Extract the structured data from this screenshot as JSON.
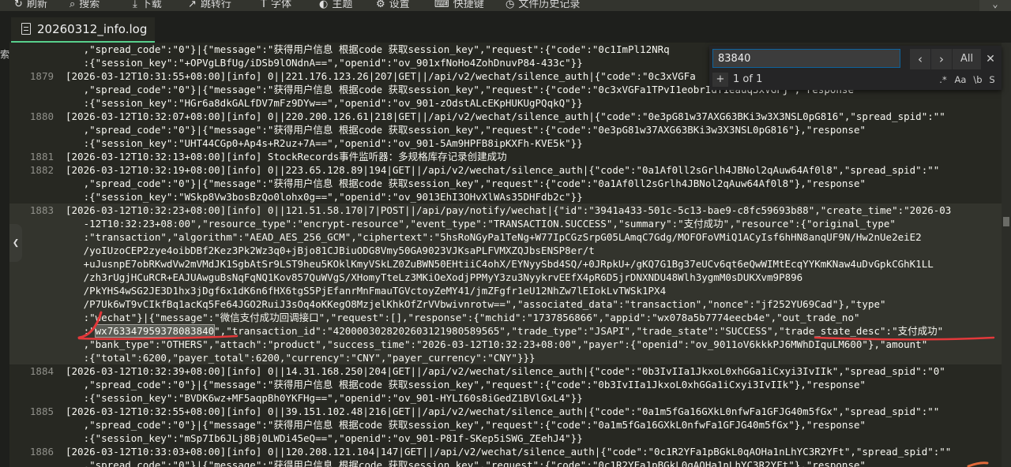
{
  "toolbar": {
    "items": [
      {
        "label": "刷新",
        "icon": "refresh-icon"
      },
      {
        "label": "搜索",
        "icon": "search-icon"
      },
      {
        "label": "下载",
        "icon": "download-icon"
      },
      {
        "label": "跳转行",
        "icon": "goto-line-icon"
      },
      {
        "label": "字体",
        "icon": "font-icon"
      },
      {
        "label": "主题",
        "icon": "theme-icon"
      },
      {
        "label": "设置",
        "icon": "gear-icon"
      },
      {
        "label": "快捷键",
        "icon": "keyboard-icon"
      },
      {
        "label": "文件历史记录",
        "icon": "history-icon"
      }
    ],
    "corner_icon": "chevron-down-icon"
  },
  "tab": {
    "title": "20260312_info.log",
    "icon": "file-icon"
  },
  "left_panel": {
    "text": "索",
    "collapse_icon": "chevron-left-icon"
  },
  "colors": {
    "background": "#272822",
    "text": "#f8f8f2",
    "line_number": "#90908a",
    "accent": "#58d08c",
    "annotation": "#e3393b"
  },
  "find": {
    "query": "83840",
    "placeholder": "",
    "prev_icon": "chevron-left-icon",
    "next_icon": "chevron-right-icon",
    "all_label": "All",
    "close_icon": "close-icon",
    "replace_toggle": "+",
    "result": "1 of 1",
    "options": [
      ".*",
      "Aa",
      "\\b",
      "S"
    ]
  },
  "lines": [
    {
      "ln": "",
      "text": "   ,\"spread_code\":\"0\"}|{\"message\":\"获得用户信息 根据code 获取session_key\",\"request\":{\"code\":\"0c1ImPl12NRq"
    },
    {
      "ln": "",
      "text": "   :{\"session_key\":\"+OPVgLBfUg/iDSb9lONdnA==\",\"openid\":\"ov_901xfNoHo4ZohDnuvP84-433c\"}}"
    },
    {
      "ln": "1879",
      "text": "[2026-03-12T10:31:55+08:00][info] 0||221.176.123.26|207|GET||/api/v2/wechat/silence_auth|{\"code\":\"0c3xVGFa"
    },
    {
      "ln": "",
      "text": "   ,\"spread_code\":\"0\"}|{\"message\":\"获得用户信息 根据code 获取session_key\",\"request\":{\"code\":\"0c3xVGFa1TPvI1eobrIdf1eauq3xVGFj\",\"response\""
    },
    {
      "ln": "",
      "text": "   :{\"session_key\":\"HGr6a8dkGALfDV7mFz9DYw==\",\"openid\":\"ov_901-zOdstALcEKpHUKUgPQqkQ\"}}"
    },
    {
      "ln": "1880",
      "text": "[2026-03-12T10:32:07+08:00][info] 0||220.200.126.61|218|GET||/api/v2/wechat/silence_auth|{\"code\":\"0e3pG81w37AXG63BKi3w3X3NSL0pG816\",\"spread_spid\":\"\""
    },
    {
      "ln": "",
      "text": "   ,\"spread_code\":\"0\"}|{\"message\":\"获得用户信息 根据code 获取session_key\",\"request\":{\"code\":\"0e3pG81w37AXG63BKi3w3X3NSL0pG816\"},\"response\""
    },
    {
      "ln": "",
      "text": "   :{\"session_key\":\"UHT44CGp0+Ap4s+R2uz+7A==\",\"openid\":\"ov_901-5Am9HPFB8ipKXFh-KVE5k\"}}"
    },
    {
      "ln": "1881",
      "text": "[2026-03-12T10:32:13+08:00][info] StockRecords事件监听器：多规格库存记录创建成功"
    },
    {
      "ln": "1882",
      "text": "[2026-03-12T10:32:19+08:00][info] 0||223.65.128.89|194|GET||/api/v2/wechat/silence_auth|{\"code\":\"0a1Af0ll2sGrlh4JBNol2qAuw64Af0l8\",\"spread_spid\":\"\""
    },
    {
      "ln": "",
      "text": "   ,\"spread_code\":\"0\"}|{\"message\":\"获得用户信息 根据code 获取session_key\",\"request\":{\"code\":\"0a1Af0ll2sGrlh4JBNol2qAuw64Af0l8\"},\"response\""
    },
    {
      "ln": "",
      "text": "   :{\"session_key\":\"WSkp8Vw3bosBzQo0lohx0g==\",\"openid\":\"ov_9013EhI3OHvXlWAs35DHFdb2c\"}}"
    },
    {
      "ln": "1883",
      "text": "[2026-03-12T10:32:23+08:00][info] 0||121.51.58.170|7|POST||/api/pay/notify/wechat|{\"id\":\"3941a433-501c-5c13-bae9-c8fc59693b88\",\"create_time\":\"2026-03"
    },
    {
      "ln": "",
      "text": "   -12T10:32:23+08:00\",\"resource_type\":\"encrypt-resource\",\"event_type\":\"TRANSACTION.SUCCESS\",\"summary\":\"支付成功\",\"resource\":{\"original_type\""
    },
    {
      "ln": "",
      "text": "   :\"transaction\",\"algorithm\":\"AEAD_AES_256_GCM\",\"ciphertext\":\"5hsRoNGyPa1TeNg+W77IpCGzSrpG05LAmqC7Gdg/MOFOFoVMiQ1ACyIsf6hHN8anqUF9N/Hw2nUe2eiE2"
    },
    {
      "ln": "",
      "text": "   /yoIUzoCEP2zye4oibDBf2Kez3Pk2Wz3q0+jBjo81CJBiuODG8Vmy50GA9023VJKsaPLFVMXZQJbsENSP8er/t"
    },
    {
      "ln": "",
      "text": "   +uJusnpE7obRKwdVw2mVMdJK1SgbAtSr9LST9heu5KOklKmyVSkLZ0ZuBWN50EHtiiC4ohX/EYNyySbd4SQ/+0JRpkU+/gKQ7G1Bg37eUCv6qt6eQwWIMtEcqYYKmKNaw4uDvGpkCGhK1LL"
    },
    {
      "ln": "",
      "text": "   /zh3rUgjHCuRCR+EAJUAwguBsNqFqNQ1Kov857QuWVgS/XHomyTteLz3MKiOeXodjPPMyY3zu3NyykrvEEfX4pR6D5jrDNXNDU48Wlh3ygmM0sDUKXvm9P896"
    },
    {
      "ln": "",
      "text": "   /PkYHS4wSG2JE3D1hx3jDgf6x1dK6n6fHX6tgS5PjEfanrMnFmauTGVctoyZeMY41/jmZFgfr1eU12NhZw7lEIokLvTWSk1PX4"
    },
    {
      "ln": "",
      "text": "   /P7Uk6wT9vCIkfBq1acKq5Fe64JGO2RuiJ3sOq4oKKegO8MzjelKhkOfZrVVbwivnrotw==\",\"associated_data\":\"transaction\",\"nonce\":\"jf252YU69Cad\"},\"type\""
    },
    {
      "ln": "",
      "text": "   :\"wechat\"}|{\"message\":\"微信支付成功回调接口\",\"request\":[],\"response\":{\"mchid\":\"1737856866\",\"appid\":\"wx078a5b7774eecb4e\",\"out_trade_no\""
    },
    {
      "ln": "",
      "prefix": "   :\"",
      "match": "wx763347959378083840",
      "suffix": "\",\"transaction_id\":\"4200003028202603121980589565\",\"trade_type\":\"JSAPI\",\"trade_state\":\"SUCCESS\",\"trade_state_desc\":\"支付成功\""
    },
    {
      "ln": "",
      "text": "   ,\"bank_type\":\"OTHERS\",\"attach\":\"product\",\"success_time\":\"2026-03-12T10:32:23+08:00\",\"payer\":{\"openid\":\"ov_9011oV6kkkPJ6MWhDIquLM600\"},\"amount\""
    },
    {
      "ln": "",
      "text": "   :{\"total\":6200,\"payer_total\":6200,\"currency\":\"CNY\",\"payer_currency\":\"CNY\"}}}"
    },
    {
      "ln": "1884",
      "text": "[2026-03-12T10:32:39+08:00][info] 0||14.31.168.250|204|GET||/api/v2/wechat/silence_auth|{\"code\":\"0b3IvIIa1JkxoL0xhGGa1iCxyi3IvIIk\",\"spread_spid\":\"0\""
    },
    {
      "ln": "",
      "text": "   ,\"spread_code\":\"0\"}|{\"message\":\"获得用户信息 根据code 获取session_key\",\"request\":{\"code\":\"0b3IvIIa1JkxoL0xhGGa1iCxyi3IvIIk\"},\"response\""
    },
    {
      "ln": "",
      "text": "   :{\"session_key\":\"BVDK6wz+MF5aqpBh0YKFHg==\",\"openid\":\"ov_901-HYLI60s8iGedZ1BVlGxL4\"}}"
    },
    {
      "ln": "1885",
      "text": "[2026-03-12T10:32:55+08:00][info] 0||39.151.102.48|216|GET||/api/v2/wechat/silence_auth|{\"code\":\"0a1m5fGa16GXkL0nfwFa1GFJG40m5fGx\",\"spread_spid\":\"\""
    },
    {
      "ln": "",
      "text": "   ,\"spread_code\":\"0\"}|{\"message\":\"获得用户信息 根据code 获取session_key\",\"request\":{\"code\":\"0a1m5fGa16GXkL0nfwFa1GFJG40m5fGx\"},\"response\""
    },
    {
      "ln": "",
      "text": "   :{\"session_key\":\"mSp7Ib6JLj8Bj0LWDi45eQ==\",\"openid\":\"ov_901-P81f-SKep5iSWG_ZEehJ4\"}}"
    },
    {
      "ln": "1886",
      "text": "[2026-03-12T10:33:03+08:00][info] 0||120.208.121.104|147|GET||/api/v2/wechat/silence_auth|{\"code\":\"0c1R2YFa1pBGkL0qAOHa1nLhYC3R2YFt\",\"spread_spid\":\"\""
    },
    {
      "ln": "",
      "text": "   ,\"spread_code\":\"0\"}|{\"message\":\"获得用户信息 根据code 获取session_key\",\"request\":{\"code\":\"0c1R2YFa1pBGkL0qAOHa1nLhYC3R2YFt\"},\"response\""
    }
  ]
}
